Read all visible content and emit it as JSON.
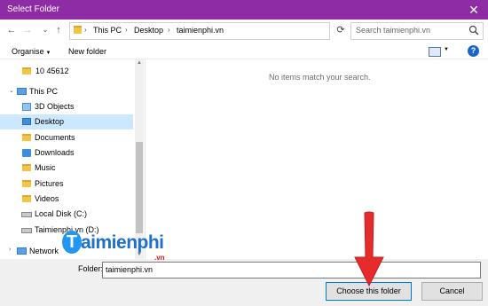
{
  "window": {
    "title": "Select Folder",
    "close_glyph": "✕"
  },
  "nav": {
    "back": "←",
    "forward": "→",
    "up_dropdown": "⌄",
    "up": "↑"
  },
  "address": {
    "crumbs": [
      "This PC",
      "Desktop",
      "taimienphi.vn"
    ],
    "separator": "›",
    "dropdown": "⌄"
  },
  "refresh_glyph": "⟳",
  "search": {
    "placeholder": "Search taimienphi.vn"
  },
  "toolbar": {
    "organise_label": "Organise",
    "organise_caret": "▼",
    "new_folder_label": "New folder",
    "view_caret": "▼",
    "help_glyph": "?"
  },
  "tree": [
    {
      "label": "10 45612",
      "icon": "folder-icon"
    },
    {
      "label": "This PC",
      "icon": "computer-icon"
    },
    {
      "label": "3D Objects",
      "icon": "3d-objects-icon"
    },
    {
      "label": "Desktop",
      "icon": "desktop-folder-icon",
      "selected": true
    },
    {
      "label": "Documents",
      "icon": "documents-icon"
    },
    {
      "label": "Downloads",
      "icon": "downloads-icon"
    },
    {
      "label": "Music",
      "icon": "music-icon"
    },
    {
      "label": "Pictures",
      "icon": "pictures-icon"
    },
    {
      "label": "Videos",
      "icon": "videos-icon"
    },
    {
      "label": "Local Disk (C:)",
      "icon": "drive-icon"
    },
    {
      "label": "Taimienphi.vn (D:)",
      "icon": "drive-icon"
    },
    {
      "label": "Network",
      "icon": "network-icon"
    }
  ],
  "content": {
    "empty_message": "No items match your search."
  },
  "footer": {
    "folder_label": "Folder:",
    "folder_value": "taimienphi.vn",
    "choose_button": "Choose this folder",
    "cancel_button": "Cancel"
  },
  "watermark": {
    "text": "aimienphi",
    "t_letter": "T",
    "suffix": ".vn"
  },
  "colors": {
    "title_bar": "#8d2ca5",
    "selected_row": "#cce8ff",
    "arrow": "#e52b2b",
    "watermark": "#1f6fd1"
  }
}
